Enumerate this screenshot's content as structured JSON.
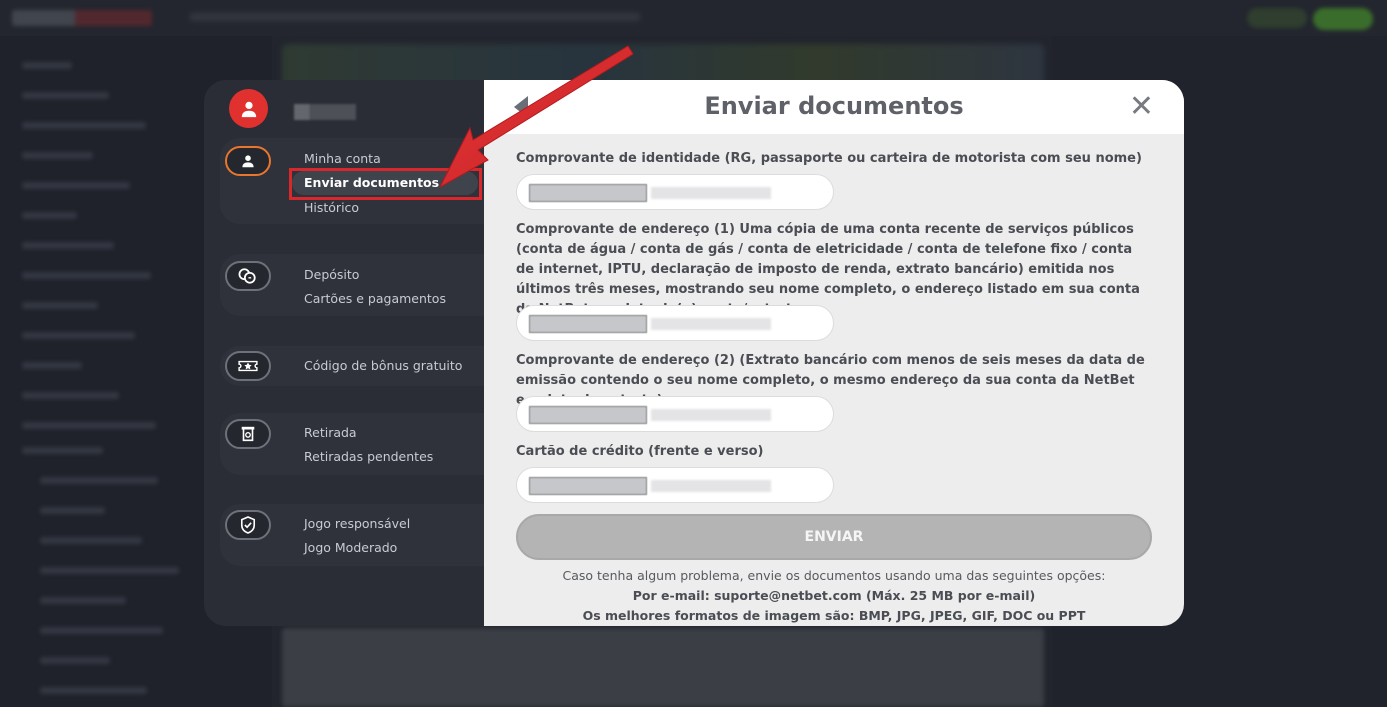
{
  "colors": {
    "accent_red": "#e0312f",
    "arrow_red": "#d8282c",
    "active_ring": "#e8762f",
    "button_disabled": "#b4b4b4"
  },
  "sidebar": {
    "groups": [
      {
        "icon": "user-icon",
        "items": [
          "Minha conta",
          "Enviar documentos",
          "Histórico"
        ],
        "selected": "Enviar documentos"
      },
      {
        "icon": "deposit-coin-icon",
        "items": [
          "Depósito",
          "Cartões e pagamentos"
        ]
      },
      {
        "icon": "bonus-star-icon",
        "items": [
          "Código de bônus gratuito"
        ]
      },
      {
        "icon": "withdraw-icon",
        "items": [
          "Retirada",
          "Retiradas pendentes"
        ]
      },
      {
        "icon": "shield-check-icon",
        "items": [
          "Jogo responsável",
          "Jogo Moderado"
        ]
      }
    ]
  },
  "modal": {
    "title": "Enviar documentos",
    "fields": [
      {
        "label": "Comprovante de identidade (RG, passaporte ou carteira de motorista com seu nome)"
      },
      {
        "label": "Comprovante de endereço (1) Uma cópia de uma conta recente de serviços públicos (conta de água / conta de gás / conta de eletricidade / conta de telefone fixo / conta de internet, IPTU, declaração de imposto de renda, extrato bancário) emitida nos últimos três meses, mostrando seu nome completo, o endereço listado em sua conta da NetBet e a data da(o) conta/extrato."
      },
      {
        "label": "Comprovante de endereço (2) (Extrato bancário com menos de seis meses da data de emissão contendo o seu nome completo, o mesmo endereço da sua conta da NetBet e a data do extrato)"
      },
      {
        "label": "Cartão de crédito (frente e verso)"
      }
    ],
    "send_label": "ENVIAR",
    "info": [
      "Caso tenha algum problema, envie os documentos usando uma das seguintes opções:",
      "Por e-mail: suporte@netbet.com (Máx. 25 MB por e-mail)",
      "Os melhores formatos de imagem são: BMP, JPG, JPEG, GIF, DOC ou PPT"
    ]
  }
}
